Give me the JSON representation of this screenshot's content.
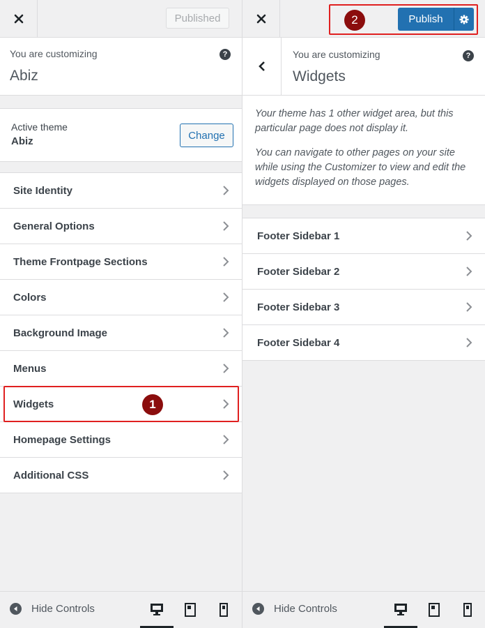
{
  "left_panel": {
    "published_label": "Published",
    "customizing_label": "You are customizing",
    "site_title": "Abiz",
    "active_theme_label": "Active theme",
    "active_theme_name": "Abiz",
    "change_label": "Change",
    "menu_items": [
      "Site Identity",
      "General Options",
      "Theme Frontpage Sections",
      "Colors",
      "Background Image",
      "Menus",
      "Widgets",
      "Homepage Settings",
      "Additional CSS"
    ],
    "step_badge": "1",
    "hide_controls_label": "Hide Controls"
  },
  "right_panel": {
    "publish_label": "Publish",
    "step_badge": "2",
    "customizing_label": "You are customizing",
    "section_title": "Widgets",
    "description": [
      "Your theme has 1 other widget area, but this particular page does not display it.",
      "You can navigate to other pages on your site while using the Customizer to view and edit the widgets displayed on those pages."
    ],
    "sidebars": [
      "Footer Sidebar 1",
      "Footer Sidebar 2",
      "Footer Sidebar 3",
      "Footer Sidebar 4"
    ],
    "hide_controls_label": "Hide Controls"
  },
  "icons": {
    "close": "close-icon",
    "help": "help-icon",
    "back": "chevron-left-icon",
    "chevron": "chevron-right-icon",
    "gear": "gear-icon",
    "desktop": "desktop-icon",
    "tablet": "tablet-icon",
    "mobile": "mobile-icon",
    "hide": "arrow-left-circle-icon"
  },
  "colors": {
    "accent": "#2271b1",
    "annotation": "#e02020",
    "badge": "#8b0d0d"
  }
}
